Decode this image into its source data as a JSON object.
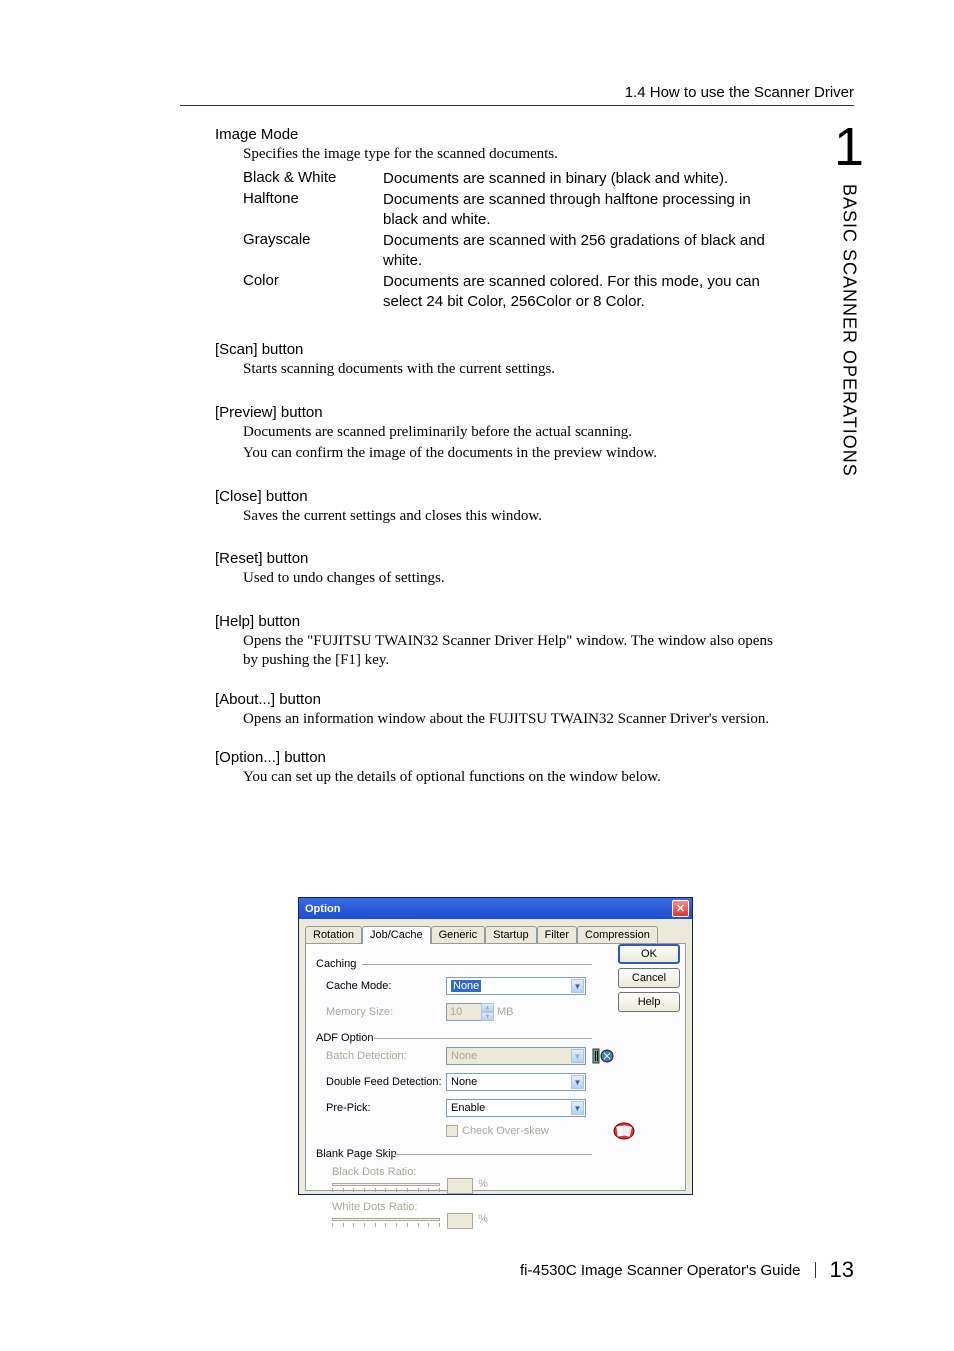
{
  "header": {
    "section_title": "1.4 How to use the Scanner Driver"
  },
  "chapter_tab": {
    "number": "1",
    "label": "BASIC SCANNER OPERATIONS"
  },
  "sections": {
    "image_mode": {
      "title": "Image Mode",
      "desc": "Specifies the image type for the scanned documents.",
      "rows": [
        {
          "label": "Black & White",
          "desc": "Documents are scanned in binary (black and white)."
        },
        {
          "label": "Halftone",
          "desc": "Documents are scanned through halftone processing in black and white."
        },
        {
          "label": "Grayscale",
          "desc": "Documents are scanned with 256 gradations of black and white."
        },
        {
          "label": "Color",
          "desc": "Documents are scanned colored. For this mode, you can select 24 bit Color, 256Color or 8 Color."
        }
      ]
    },
    "scan": {
      "title": "[Scan] button",
      "desc": "Starts scanning documents with the current settings."
    },
    "preview": {
      "title": "[Preview] button",
      "desc1": "Documents are scanned preliminarily before the actual scanning.",
      "desc2": "You can confirm the image of the documents in the preview window."
    },
    "close": {
      "title": "[Close] button",
      "desc": "Saves the current settings and closes this window."
    },
    "reset": {
      "title": "[Reset] button",
      "desc": "Used to undo changes of settings."
    },
    "help": {
      "title": "[Help] button",
      "desc": "Opens the \"FUJITSU TWAIN32 Scanner Driver Help\" window. The window also opens by pushing the [F1] key."
    },
    "about": {
      "title": "[About...] button",
      "desc": "Opens an information window about the FUJITSU TWAIN32 Scanner Driver's version."
    },
    "option": {
      "title": "[Option...] button",
      "desc": "You can set up the details of optional functions on the window below."
    }
  },
  "dialog": {
    "title": "Option",
    "tabs": [
      "Rotation",
      "Job/Cache",
      "Generic",
      "Startup",
      "Filter",
      "Compression"
    ],
    "active_tab": 1,
    "buttons": {
      "ok": "OK",
      "cancel": "Cancel",
      "help": "Help"
    },
    "caching": {
      "group": "Caching",
      "cache_mode": {
        "label": "Cache Mode:",
        "value": "None"
      },
      "memory_size": {
        "label": "Memory Size:",
        "value": "10",
        "unit": "MB"
      }
    },
    "adf_option": {
      "group": "ADF Option",
      "batch_detection": {
        "label": "Batch Detection:",
        "value": "None"
      },
      "double_feed": {
        "label": "Double Feed Detection:",
        "value": "None"
      },
      "pre_pick": {
        "label": "Pre-Pick:",
        "value": "Enable"
      },
      "check_overskew": "Check Over-skew"
    },
    "blank_page_skip": {
      "group": "Blank Page Skip",
      "black_dots": "Black Dots Ratio:",
      "white_dots": "White Dots Ratio:",
      "percent": "%"
    }
  },
  "footer": {
    "guide": "fi-4530C Image Scanner Operator's Guide",
    "page": "13"
  }
}
